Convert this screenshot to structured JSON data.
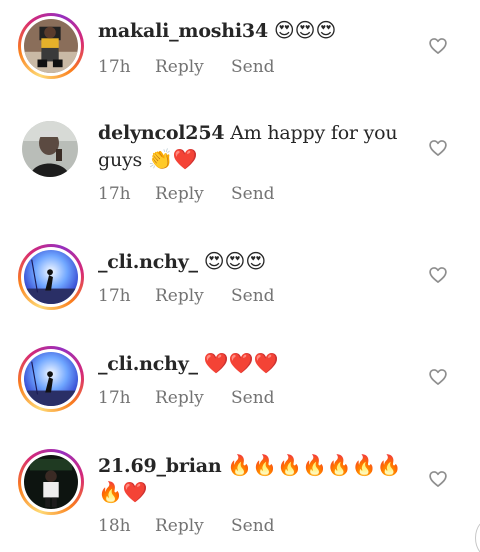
{
  "comments": [
    {
      "username": "makali_moshi34",
      "text": "",
      "emoji": "😍😍😍",
      "emoji_line2": "",
      "time": "17h",
      "reply": "Reply",
      "send": "Send",
      "avatar": "story-ring",
      "like_icon": "heart-outline-icon"
    },
    {
      "username": "delyncol254",
      "text": "Am happy for you guys",
      "emoji": "👏❤️",
      "emoji_line2": "",
      "time": "17h",
      "reply": "Reply",
      "send": "Send",
      "avatar": "plain",
      "like_icon": "heart-outline-icon"
    },
    {
      "username": "_cli.nchy_",
      "text": "",
      "emoji": "😍😍😍",
      "emoji_line2": "",
      "time": "17h",
      "reply": "Reply",
      "send": "Send",
      "avatar": "story-ring",
      "like_icon": "heart-outline-icon"
    },
    {
      "username": "_cli.nchy_",
      "text": "",
      "emoji": "❤️❤️❤️",
      "emoji_line2": "",
      "time": "17h",
      "reply": "Reply",
      "send": "Send",
      "avatar": "story-ring",
      "like_icon": "heart-outline-icon"
    },
    {
      "username": "21.69_brian",
      "text": "",
      "emoji": "🔥🔥🔥🔥🔥🔥🔥",
      "emoji_line2": "🔥❤️",
      "time": "18h",
      "reply": "Reply",
      "send": "Send",
      "avatar": "story-ring",
      "like_icon": "heart-outline-icon"
    }
  ],
  "colors": {
    "text": "#262626",
    "meta": "#737373",
    "ring_start": "#feda75",
    "ring_end": "#962fbf"
  }
}
